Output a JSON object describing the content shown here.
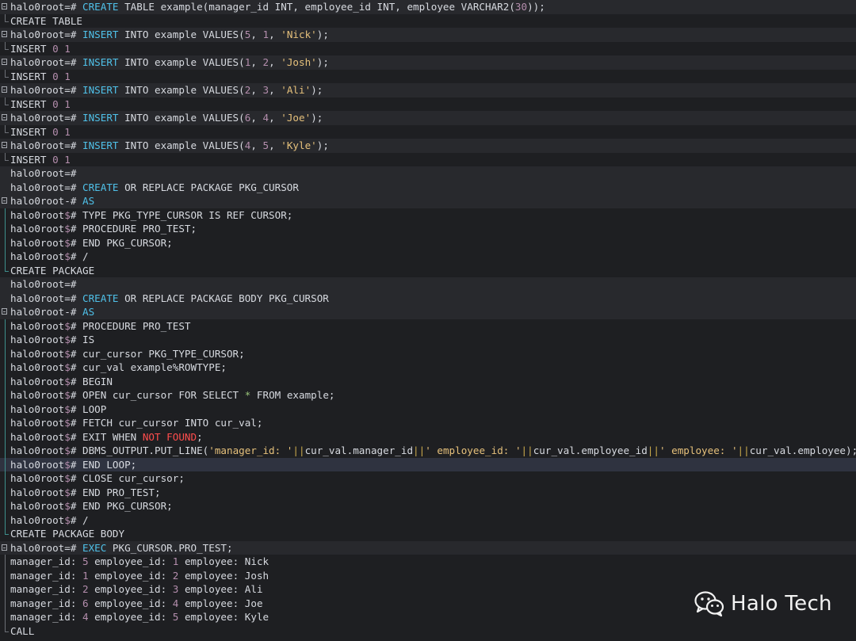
{
  "terminal": {
    "lines": [
      {
        "kind": "cmd box",
        "segs": [
          [
            "halo0root=# ",
            "d"
          ],
          [
            "CREATE",
            "k"
          ],
          [
            " TABLE example(manager_id INT, employee_id INT, employee VARCHAR2(",
            "d"
          ],
          [
            "30",
            "n"
          ],
          [
            "));",
            "d"
          ]
        ]
      },
      {
        "kind": "out end",
        "segs": [
          [
            "CREATE TABLE",
            "d"
          ]
        ]
      },
      {
        "kind": "cmd box",
        "segs": [
          [
            "halo0root=# ",
            "d"
          ],
          [
            "INSERT",
            "k"
          ],
          [
            " INTO example VALUES(",
            "d"
          ],
          [
            "5",
            "n"
          ],
          [
            ", ",
            "d"
          ],
          [
            "1",
            "n"
          ],
          [
            ", ",
            "d"
          ],
          [
            "'Nick'",
            "s"
          ],
          [
            ");",
            "d"
          ]
        ]
      },
      {
        "kind": "out end",
        "segs": [
          [
            "INSERT ",
            "d"
          ],
          [
            "0",
            "n"
          ],
          [
            " ",
            "d"
          ],
          [
            "1",
            "n"
          ]
        ]
      },
      {
        "kind": "cmd box",
        "segs": [
          [
            "halo0root=# ",
            "d"
          ],
          [
            "INSERT",
            "k"
          ],
          [
            " INTO example VALUES(",
            "d"
          ],
          [
            "1",
            "n"
          ],
          [
            ", ",
            "d"
          ],
          [
            "2",
            "n"
          ],
          [
            ", ",
            "d"
          ],
          [
            "'Josh'",
            "s"
          ],
          [
            ");",
            "d"
          ]
        ]
      },
      {
        "kind": "out end",
        "segs": [
          [
            "INSERT ",
            "d"
          ],
          [
            "0",
            "n"
          ],
          [
            " ",
            "d"
          ],
          [
            "1",
            "n"
          ]
        ]
      },
      {
        "kind": "cmd box",
        "segs": [
          [
            "halo0root=# ",
            "d"
          ],
          [
            "INSERT",
            "k"
          ],
          [
            " INTO example VALUES(",
            "d"
          ],
          [
            "2",
            "n"
          ],
          [
            ", ",
            "d"
          ],
          [
            "3",
            "n"
          ],
          [
            ", ",
            "d"
          ],
          [
            "'Ali'",
            "s"
          ],
          [
            ");",
            "d"
          ]
        ]
      },
      {
        "kind": "out end",
        "segs": [
          [
            "INSERT ",
            "d"
          ],
          [
            "0",
            "n"
          ],
          [
            " ",
            "d"
          ],
          [
            "1",
            "n"
          ]
        ]
      },
      {
        "kind": "cmd box",
        "segs": [
          [
            "halo0root=# ",
            "d"
          ],
          [
            "INSERT",
            "k"
          ],
          [
            " INTO example VALUES(",
            "d"
          ],
          [
            "6",
            "n"
          ],
          [
            ", ",
            "d"
          ],
          [
            "4",
            "n"
          ],
          [
            ", ",
            "d"
          ],
          [
            "'Joe'",
            "s"
          ],
          [
            ");",
            "d"
          ]
        ]
      },
      {
        "kind": "out end",
        "segs": [
          [
            "INSERT ",
            "d"
          ],
          [
            "0",
            "n"
          ],
          [
            " ",
            "d"
          ],
          [
            "1",
            "n"
          ]
        ]
      },
      {
        "kind": "cmd box",
        "segs": [
          [
            "halo0root=# ",
            "d"
          ],
          [
            "INSERT",
            "k"
          ],
          [
            " INTO example VALUES(",
            "d"
          ],
          [
            "4",
            "n"
          ],
          [
            ", ",
            "d"
          ],
          [
            "5",
            "n"
          ],
          [
            ", ",
            "d"
          ],
          [
            "'Kyle'",
            "s"
          ],
          [
            ");",
            "d"
          ]
        ]
      },
      {
        "kind": "out end",
        "segs": [
          [
            "INSERT ",
            "d"
          ],
          [
            "0",
            "n"
          ],
          [
            " ",
            "d"
          ],
          [
            "1",
            "n"
          ]
        ]
      },
      {
        "kind": "cmd",
        "segs": [
          [
            "halo0root=#",
            "d"
          ]
        ]
      },
      {
        "kind": "cmd",
        "segs": [
          [
            "halo0root=# ",
            "d"
          ],
          [
            "CREATE",
            "k"
          ],
          [
            " OR REPLACE PACKAGE PKG_CURSOR",
            "d"
          ]
        ]
      },
      {
        "kind": "cmd box",
        "segs": [
          [
            "halo0root-# ",
            "d"
          ],
          [
            "AS",
            "k"
          ]
        ]
      },
      {
        "kind": "out rail",
        "segs": [
          [
            "halo0root",
            "d"
          ],
          [
            "$",
            "m"
          ],
          [
            "# TYPE PKG_TYPE_CURSOR IS REF CURSOR;",
            "d"
          ]
        ]
      },
      {
        "kind": "out rail",
        "segs": [
          [
            "halo0root",
            "d"
          ],
          [
            "$",
            "m"
          ],
          [
            "# PROCEDURE PRO_TEST;",
            "d"
          ]
        ]
      },
      {
        "kind": "out rail",
        "segs": [
          [
            "halo0root",
            "d"
          ],
          [
            "$",
            "m"
          ],
          [
            "# END PKG_CURSOR;",
            "d"
          ]
        ]
      },
      {
        "kind": "out rail",
        "segs": [
          [
            "halo0root",
            "d"
          ],
          [
            "$",
            "m"
          ],
          [
            "# /",
            "d"
          ]
        ]
      },
      {
        "kind": "out end-t",
        "segs": [
          [
            "CREATE PACKAGE",
            "d"
          ]
        ]
      },
      {
        "kind": "cmd",
        "segs": [
          [
            "halo0root=#",
            "d"
          ]
        ]
      },
      {
        "kind": "cmd",
        "segs": [
          [
            "halo0root=# ",
            "d"
          ],
          [
            "CREATE",
            "k"
          ],
          [
            " OR REPLACE PACKAGE BODY PKG_CURSOR",
            "d"
          ]
        ]
      },
      {
        "kind": "cmd box",
        "segs": [
          [
            "halo0root-# ",
            "d"
          ],
          [
            "AS",
            "k"
          ]
        ]
      },
      {
        "kind": "out rail",
        "segs": [
          [
            "halo0root",
            "d"
          ],
          [
            "$",
            "m"
          ],
          [
            "# PROCEDURE PRO_TEST",
            "d"
          ]
        ]
      },
      {
        "kind": "out rail",
        "segs": [
          [
            "halo0root",
            "d"
          ],
          [
            "$",
            "m"
          ],
          [
            "# IS",
            "d"
          ]
        ]
      },
      {
        "kind": "out rail",
        "segs": [
          [
            "halo0root",
            "d"
          ],
          [
            "$",
            "m"
          ],
          [
            "# cur_cursor PKG_TYPE_CURSOR;",
            "d"
          ]
        ]
      },
      {
        "kind": "out rail",
        "segs": [
          [
            "halo0root",
            "d"
          ],
          [
            "$",
            "m"
          ],
          [
            "# cur_val example%ROWTYPE;",
            "d"
          ]
        ]
      },
      {
        "kind": "out rail",
        "segs": [
          [
            "halo0root",
            "d"
          ],
          [
            "$",
            "m"
          ],
          [
            "# BEGIN",
            "d"
          ]
        ]
      },
      {
        "kind": "out rail",
        "segs": [
          [
            "halo0root",
            "d"
          ],
          [
            "$",
            "m"
          ],
          [
            "# OPEN cur_cursor FOR SELECT ",
            "d"
          ],
          [
            "*",
            "g"
          ],
          [
            " FROM example;",
            "d"
          ]
        ]
      },
      {
        "kind": "out rail",
        "segs": [
          [
            "halo0root",
            "d"
          ],
          [
            "$",
            "m"
          ],
          [
            "# LOOP",
            "d"
          ]
        ]
      },
      {
        "kind": "out rail",
        "segs": [
          [
            "halo0root",
            "d"
          ],
          [
            "$",
            "m"
          ],
          [
            "# FETCH cur_cursor INTO cur_val;",
            "d"
          ]
        ]
      },
      {
        "kind": "out rail",
        "segs": [
          [
            "halo0root",
            "d"
          ],
          [
            "$",
            "m"
          ],
          [
            "# EXIT WHEN ",
            "d"
          ],
          [
            "NOT FOUND",
            "r"
          ],
          [
            ";",
            "d"
          ]
        ]
      },
      {
        "kind": "out rail",
        "segs": [
          [
            "halo0root",
            "d"
          ],
          [
            "$",
            "m"
          ],
          [
            "# DBMS_OUTPUT.PUT_LINE(",
            "d"
          ],
          [
            "'manager_id: '",
            "s"
          ],
          [
            "||",
            "p"
          ],
          [
            "cur_val.manager_id",
            "d"
          ],
          [
            "||",
            "p"
          ],
          [
            "' employee_id: '",
            "s"
          ],
          [
            "||",
            "p"
          ],
          [
            "cur_val.employee_id",
            "d"
          ],
          [
            "||",
            "p"
          ],
          [
            "' employee: '",
            "s"
          ],
          [
            "||",
            "p"
          ],
          [
            "cur_val.employee);",
            "d"
          ]
        ]
      },
      {
        "kind": "out rail hl",
        "segs": [
          [
            "halo0root",
            "d"
          ],
          [
            "$",
            "m"
          ],
          [
            "# END LOOP;",
            "d"
          ]
        ]
      },
      {
        "kind": "out rail",
        "segs": [
          [
            "halo0root",
            "d"
          ],
          [
            "$",
            "m"
          ],
          [
            "# CLOSE cur_cursor;",
            "d"
          ]
        ]
      },
      {
        "kind": "out rail",
        "segs": [
          [
            "halo0root",
            "d"
          ],
          [
            "$",
            "m"
          ],
          [
            "# END PRO_TEST;",
            "d"
          ]
        ]
      },
      {
        "kind": "out rail",
        "segs": [
          [
            "halo0root",
            "d"
          ],
          [
            "$",
            "m"
          ],
          [
            "# END PKG_CURSOR;",
            "d"
          ]
        ]
      },
      {
        "kind": "out rail",
        "segs": [
          [
            "halo0root",
            "d"
          ],
          [
            "$",
            "m"
          ],
          [
            "# /",
            "d"
          ]
        ]
      },
      {
        "kind": "out end-t",
        "segs": [
          [
            "CREATE PACKAGE BODY",
            "d"
          ]
        ]
      },
      {
        "kind": "cmd box",
        "segs": [
          [
            "halo0root=# ",
            "d"
          ],
          [
            "EXEC",
            "k"
          ],
          [
            " PKG_CURSOR.PRO_TEST;",
            "d"
          ]
        ]
      },
      {
        "kind": "out rail-g",
        "segs": [
          [
            "manager_id",
            "d"
          ],
          [
            ": ",
            "d"
          ],
          [
            "5",
            "n"
          ],
          [
            " employee_id",
            "d"
          ],
          [
            ": ",
            "d"
          ],
          [
            "1",
            "n"
          ],
          [
            " employee",
            "d"
          ],
          [
            ": Nick",
            "d"
          ]
        ]
      },
      {
        "kind": "out rail-g",
        "segs": [
          [
            "manager_id",
            "d"
          ],
          [
            ": ",
            "d"
          ],
          [
            "1",
            "n"
          ],
          [
            " employee_id",
            "d"
          ],
          [
            ": ",
            "d"
          ],
          [
            "2",
            "n"
          ],
          [
            " employee",
            "d"
          ],
          [
            ": Josh",
            "d"
          ]
        ]
      },
      {
        "kind": "out rail-g",
        "segs": [
          [
            "manager_id",
            "d"
          ],
          [
            ": ",
            "d"
          ],
          [
            "2",
            "n"
          ],
          [
            " employee_id",
            "d"
          ],
          [
            ": ",
            "d"
          ],
          [
            "3",
            "n"
          ],
          [
            " employee",
            "d"
          ],
          [
            ": Ali",
            "d"
          ]
        ]
      },
      {
        "kind": "out rail-g",
        "segs": [
          [
            "manager_id",
            "d"
          ],
          [
            ": ",
            "d"
          ],
          [
            "6",
            "n"
          ],
          [
            " employee_id",
            "d"
          ],
          [
            ": ",
            "d"
          ],
          [
            "4",
            "n"
          ],
          [
            " employee",
            "d"
          ],
          [
            ": Joe",
            "d"
          ]
        ]
      },
      {
        "kind": "out rail-g",
        "segs": [
          [
            "manager_id",
            "d"
          ],
          [
            ": ",
            "d"
          ],
          [
            "4",
            "n"
          ],
          [
            " employee_id",
            "d"
          ],
          [
            ": ",
            "d"
          ],
          [
            "5",
            "n"
          ],
          [
            " employee",
            "d"
          ],
          [
            ": Kyle",
            "d"
          ]
        ]
      },
      {
        "kind": "out end",
        "segs": [
          [
            "CALL",
            "d"
          ]
        ]
      }
    ]
  },
  "watermark": {
    "icon": "wechat-icon",
    "text": "Halo Tech"
  },
  "colors": {
    "background": "#1e1f22",
    "keyword": "#4fc1e9",
    "number": "#b48ead",
    "string": "#e5c07b",
    "concat": "#c8a84b",
    "not_found": "#ff4d4d",
    "star": "#98c379"
  }
}
